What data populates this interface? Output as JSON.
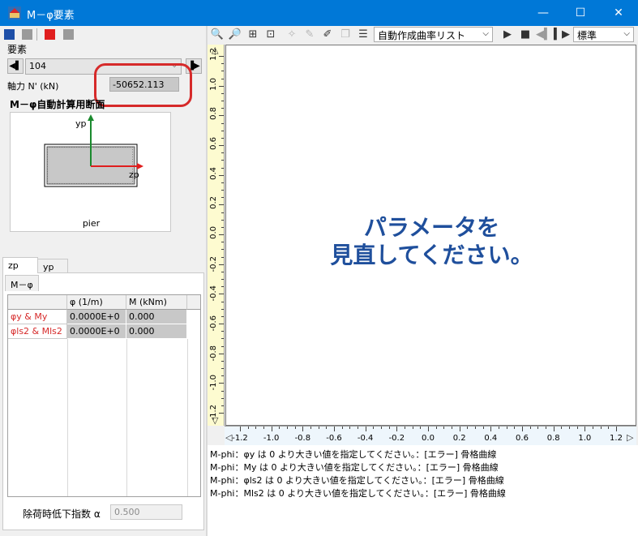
{
  "window": {
    "title": "M－φ要素",
    "minimize": "—",
    "maximize": "☐",
    "close": "✕"
  },
  "colors": {
    "accent": "#0078d7",
    "error_red": "#d62a2a",
    "message_blue": "#1f4f9c",
    "ruler_v_bg": "#fdfbd0",
    "ruler_h_bg": "#eef6fc"
  },
  "left": {
    "element_label": "要素",
    "element_value": "104",
    "prev_glyph": "◀▌",
    "next_glyph": "▐▶",
    "axial_label": "軸力 N' (kN)",
    "axial_value": "-50652.113",
    "section_heading": "M－φ自動計算用断面",
    "section_name": "pier",
    "axis_y": "yp",
    "axis_z": "zp",
    "tabs": [
      "zp",
      "yp"
    ],
    "subtab": "M－φ",
    "grid": {
      "headers": [
        "φ (1/m)",
        "M (kNm)"
      ],
      "rows": [
        {
          "label": "φy & My",
          "phi": "0.0000E+0",
          "m": "0.000"
        },
        {
          "label": "φls2 & Mls2",
          "phi": "0.0000E+0",
          "m": "0.000"
        }
      ]
    },
    "alpha_label": "除荷時低下指数 α",
    "alpha_value": "0.500"
  },
  "toolbar": {
    "icons": [
      "zoom-in-icon",
      "zoom-out-icon",
      "fit-icon",
      "frame-icon",
      "pointer-icon",
      "pin-icon",
      "pen-icon",
      "copy-icon",
      "list-icon"
    ],
    "curve_list": "自動作成曲率リスト",
    "view_mode": "標準"
  },
  "plot": {
    "message_line1": "パラメータを",
    "message_line2": "見直してください。",
    "y_ticks": [
      "1.2",
      "1.0",
      "0.8",
      "0.6",
      "0.4",
      "0.2",
      "0.0",
      "-0.2",
      "-0.4",
      "-0.6",
      "-0.8",
      "-1.0",
      "-1.2"
    ],
    "x_ticks": [
      "-1.2",
      "-1.0",
      "-0.8",
      "-0.6",
      "-0.4",
      "-0.2",
      "0.0",
      "0.2",
      "0.4",
      "0.6",
      "0.8",
      "1.0",
      "1.2"
    ]
  },
  "log": [
    "M-phi：φy は 0 より大きい値を指定してください。：[エラー] 骨格曲線",
    "M-phi：My は 0 より大きい値を指定してください。：[エラー] 骨格曲線",
    "M-phi：φls2 は 0 より大きい値を指定してください。：[エラー] 骨格曲線",
    "M-phi：Mls2 は 0 より大きい値を指定してください。：[エラー] 骨格曲線"
  ]
}
